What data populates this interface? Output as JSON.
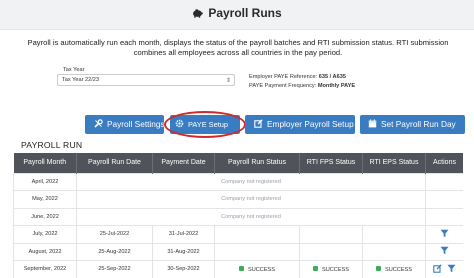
{
  "header": {
    "title": "Payroll Runs"
  },
  "intro": {
    "line1": "Payroll is automatically run each month, displays the status of the payroll batches and RTI submission status. RTI submission",
    "line2": "combines all employees across all countries in the pay period."
  },
  "tax_year": {
    "label": "Tax Year",
    "selected": "Tax Year 22/23"
  },
  "employer_info": {
    "paye_ref_label": "Employer PAYE Reference:",
    "paye_ref_value": "635 / A635",
    "freq_label": "PAYE Payment Frequency:",
    "freq_value": "Monthly PAYE"
  },
  "buttons": {
    "payroll_settings": "Payroll Settings",
    "paye_setup": "PAYE Setup",
    "employer_payroll_setup": "Employer Payroll Setup",
    "set_payroll_run_day": "Set Payroll Run Day"
  },
  "payroll_run": {
    "title": "PAYROLL RUN",
    "columns": [
      "Payroll Month",
      "Payroll Run Date",
      "Payment Date",
      "Payroll Run Status",
      "RTI FPS Status",
      "RTI EPS Status",
      "Actions"
    ],
    "rows": [
      {
        "month": "April, 2022",
        "note": "Company not registered"
      },
      {
        "month": "May, 2022",
        "note": "Company not registered"
      },
      {
        "month": "June, 2022",
        "note": "Company not registered"
      },
      {
        "month": "July, 2022",
        "run_date": "25-Jul-2022",
        "pay_date": "31-Jul-2022"
      },
      {
        "month": "August, 2022",
        "run_date": "25-Aug-2022",
        "pay_date": "31-Aug-2022"
      },
      {
        "month": "September, 2022",
        "run_date": "25-Sep-2022",
        "pay_date": "30-Sep-2022",
        "run_status": "SUCCESS",
        "fps_status": "SUCCESS",
        "eps_status": "SUCCESS"
      }
    ]
  },
  "colors": {
    "header_bg": "#50545a",
    "button": "#3a7cc2",
    "highlight": "#d02a2a",
    "success": "#3cae5a"
  },
  "icons": {
    "title": "piggy-bank-icon",
    "settings": "wrench-icon",
    "paye": "gear-icon",
    "employer": "edit-icon",
    "runday": "calendar-icon",
    "filter": "filter-icon"
  }
}
